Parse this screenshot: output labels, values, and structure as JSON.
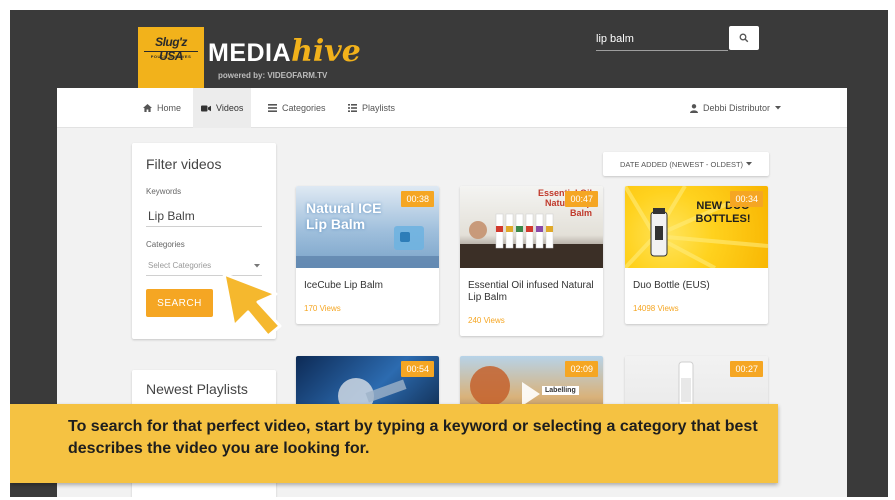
{
  "header": {
    "brand_badge": "Slug'z USA",
    "brand_tag": "POUCH SLEEVES",
    "logo_media": "MEDIA",
    "logo_hive": "hive",
    "powered_by": "powered by: VIDEOFARM.TV",
    "search_value": "lip balm"
  },
  "nav": {
    "items": [
      {
        "label": "Home",
        "icon": "home-icon"
      },
      {
        "label": "Videos",
        "icon": "video-camera-icon",
        "active": true
      },
      {
        "label": "Categories",
        "icon": "list-icon"
      },
      {
        "label": "Playlists",
        "icon": "playlist-icon"
      }
    ],
    "user_label": "Debbi Distributor"
  },
  "filter": {
    "title": "Filter videos",
    "keywords_label": "Keywords",
    "keywords_value": "Lip Balm",
    "categories_label": "Categories",
    "categories_placeholder": "Select Categories",
    "search_label": "SEARCH"
  },
  "playlists": {
    "title": "Newest Playlists"
  },
  "sort": {
    "label": "DATE ADDED (NEWEST - OLDEST)"
  },
  "videos": [
    {
      "title": "IceCube Lip Balm",
      "duration": "00:38",
      "views": "170 Views",
      "thumb_text": "Natural ICE Lip Balm"
    },
    {
      "title": "Essential Oil infused Natural Lip Balm",
      "duration": "00:47",
      "views": "240 Views",
      "thumb_text": "Essential Oil Natural Lip Balm"
    },
    {
      "title": "Duo Bottle (EUS)",
      "duration": "00:34",
      "views": "14098 Views",
      "thumb_text": "NEW DUO BOTTLES!"
    },
    {
      "title": "",
      "duration": "00:54",
      "views": ""
    },
    {
      "title": "",
      "duration": "02:09",
      "views": "",
      "thumb_text": "Labelling"
    },
    {
      "title": "",
      "duration": "00:27",
      "views": ""
    }
  ],
  "caption": {
    "text": "To search for that perfect video, start by typing a keyword or selecting a category that best describes the video you are looking for."
  },
  "colors": {
    "accent": "#f5a623",
    "caption_bg": "#f5c242",
    "frame_bg": "#3a3a3a"
  }
}
